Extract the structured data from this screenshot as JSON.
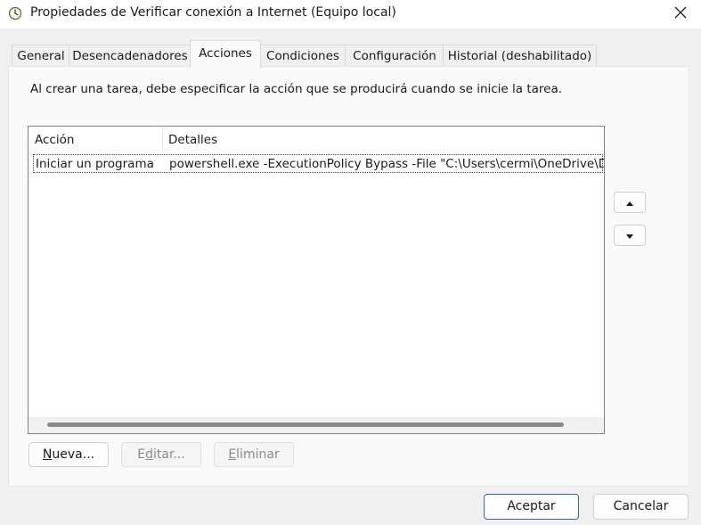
{
  "window": {
    "title": "Propiedades de Verificar conexión a Internet (Equipo local)",
    "icon": "clock-icon"
  },
  "tabs": [
    {
      "label": "General",
      "active": false
    },
    {
      "label": "Desencadenadores",
      "active": false
    },
    {
      "label": "Acciones",
      "active": true
    },
    {
      "label": "Condiciones",
      "active": false
    },
    {
      "label": "Configuración",
      "active": false
    },
    {
      "label": "Historial (deshabilitado)",
      "active": false
    }
  ],
  "actions_panel": {
    "instruction": "Al crear una tarea, debe especificar la acción que se producirá cuando se inicie la tarea.",
    "columns": [
      "Acción",
      "Detalles"
    ],
    "rows": [
      {
        "action": "Iniciar un programa",
        "details": "powershell.exe -ExecutionPolicy Bypass -File \"C:\\Users\\cermi\\OneDrive\\Desktop\\..."
      }
    ],
    "move_up_icon": "triangle-up-icon",
    "move_down_icon": "triangle-down-icon",
    "buttons": {
      "new": {
        "pre": "",
        "key": "N",
        "post": "ueva...",
        "enabled": true
      },
      "edit": {
        "pre": "E",
        "key": "d",
        "post": "itar...",
        "enabled": false
      },
      "delete": {
        "pre": "",
        "key": "E",
        "post": "liminar",
        "enabled": false
      }
    }
  },
  "footer": {
    "ok_label": "Aceptar",
    "cancel_label": "Cancelar"
  },
  "colors": {
    "window_bg": "#f0f0f0",
    "panel_bg": "#f9f9f9",
    "default_button_border": "#2a6ab0"
  }
}
